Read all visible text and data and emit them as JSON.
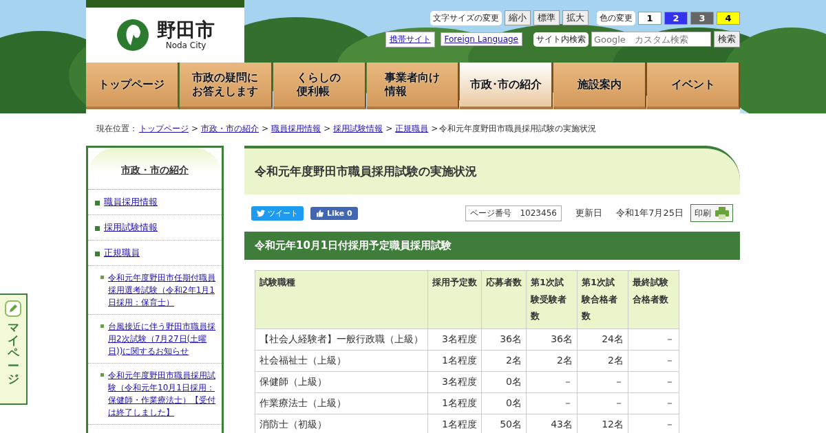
{
  "logo": {
    "name": "野田市",
    "sub": "Noda City"
  },
  "font_size": {
    "label": "文字サイズの変更",
    "buttons": [
      "縮小",
      "標準",
      "拡大"
    ]
  },
  "color_change": {
    "label": "色の変更",
    "options": [
      {
        "label": "1",
        "color": "#ffffff"
      },
      {
        "label": "2",
        "color": "#3333ee"
      },
      {
        "label": "3",
        "color": "#666666"
      },
      {
        "label": "4",
        "color": "#ffff00"
      }
    ]
  },
  "links": [
    "携帯サイト",
    "Foreign Language"
  ],
  "search": {
    "label": "サイト内検索",
    "placeholder": "Google　カスタム検索",
    "button": "検索"
  },
  "nav": [
    {
      "lines": [
        "トップページ"
      ],
      "selected": false
    },
    {
      "lines": [
        "市政の疑問に",
        "お答えします"
      ],
      "selected": false
    },
    {
      "lines": [
        "くらしの",
        "便利帳"
      ],
      "selected": false
    },
    {
      "lines": [
        "事業者向け",
        "情報"
      ],
      "selected": false
    },
    {
      "lines": [
        "市政･市の紹介"
      ],
      "selected": true
    },
    {
      "lines": [
        "施設案内"
      ],
      "selected": false
    },
    {
      "lines": [
        "イベント"
      ],
      "selected": false
    }
  ],
  "breadcrumb": {
    "label": "現在位置：",
    "separator": ">",
    "links": [
      "トップページ",
      "市政・市の紹介",
      "職員採用情報",
      "採用試験情報",
      "正規職員"
    ],
    "current": "令和元年度野田市職員採用試験の実施状況"
  },
  "sidebar": {
    "title": "市政・市の紹介",
    "items": [
      {
        "label": "職員採用情報"
      },
      {
        "label": "採用試験情報"
      },
      {
        "label": "正規職員",
        "children": [
          {
            "label": "令和元年度野田市任期付職員採用選考試験（令和2年1月1日採用：保育士）"
          },
          {
            "label": "台風接近に伴う野田市職員採用2次試験（7月27日(土曜日))に関するお知らせ"
          },
          {
            "label": "令和元年度野田市職員採用試験（令和元年10月1日採用：保健師・作業療法士）【受付は終了しました】"
          }
        ]
      }
    ]
  },
  "mypage": "マイページ",
  "page_title": "令和元年度野田市職員採用試験の実施状況",
  "share": {
    "tweet": "ツイート",
    "like": "Like 0"
  },
  "page_number": {
    "label": "ページ番号",
    "value": "1023456"
  },
  "updated": {
    "label": "更新日",
    "value": "令和1年7月25日"
  },
  "print": "印刷",
  "section_title": "令和元年10月1日付採用予定職員採用試験",
  "table": {
    "columns": [
      "試験職種",
      "採用予定数",
      "応募者数",
      "第1次試験受験者数",
      "第1次試験合格者数",
      "最終試験合格者数"
    ],
    "rows": [
      [
        "【社会人経験者】一般行政職（上級）",
        "3名程度",
        "36名",
        "36名",
        "24名",
        "－"
      ],
      [
        "社会福祉士（上級）",
        "1名程度",
        "2名",
        "2名",
        "2名",
        "－"
      ],
      [
        "保健師（上級）",
        "3名程度",
        "0名",
        "－",
        "－",
        "－"
      ],
      [
        "作業療法士（上級）",
        "1名程度",
        "0名",
        "－",
        "－",
        "－"
      ],
      [
        "消防士（初級）",
        "1名程度",
        "50名",
        "43名",
        "12名",
        "－"
      ]
    ]
  }
}
